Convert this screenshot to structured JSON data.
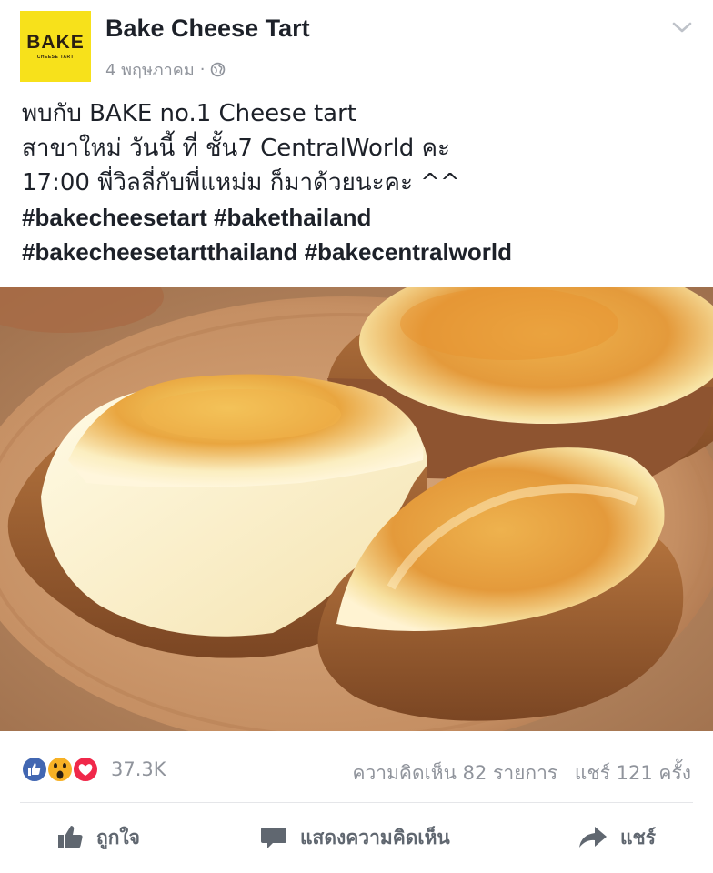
{
  "post": {
    "page_name": "Bake Cheese Tart",
    "avatar_text": "BAKE",
    "avatar_subtext": "CHEESE TART",
    "timestamp": "4 พฤษภาคม",
    "separator": "·",
    "privacy_icon": "globe-icon",
    "menu_icon": "chevron-down-icon",
    "text_lines": [
      "พบกับ BAKE no.1 Cheese tart",
      "สาขาใหม่ วันนี้ ที่  ชั้น7 CentralWorld คะ",
      "17:00 พี่วิลลี่กับพี่แหม่ม ก็มาด้วยนะคะ ^^"
    ],
    "hashtag_lines": [
      "#bakecheesetart #bakethailand",
      "#bakecheesetartthailand #bakecentralworld"
    ],
    "photo_icon": "cheese-tart-photo"
  },
  "reactions": {
    "icons": [
      "like-icon",
      "wow-icon",
      "love-icon"
    ],
    "count": "37.3K",
    "comments": "ความคิดเห็น 82 รายการ",
    "shares": "แชร์ 121 ครั้ง"
  },
  "actions": {
    "like": "ถูกใจ",
    "comment": "แสดงความคิดเห็น",
    "share": "แชร์"
  },
  "colors": {
    "brand_yellow": "#f7e11b",
    "like_blue": "#4267b2",
    "love_red": "#f0284a",
    "wow_yellow": "#f7b125",
    "meta_gray": "#90949c",
    "action_gray": "#606770"
  }
}
